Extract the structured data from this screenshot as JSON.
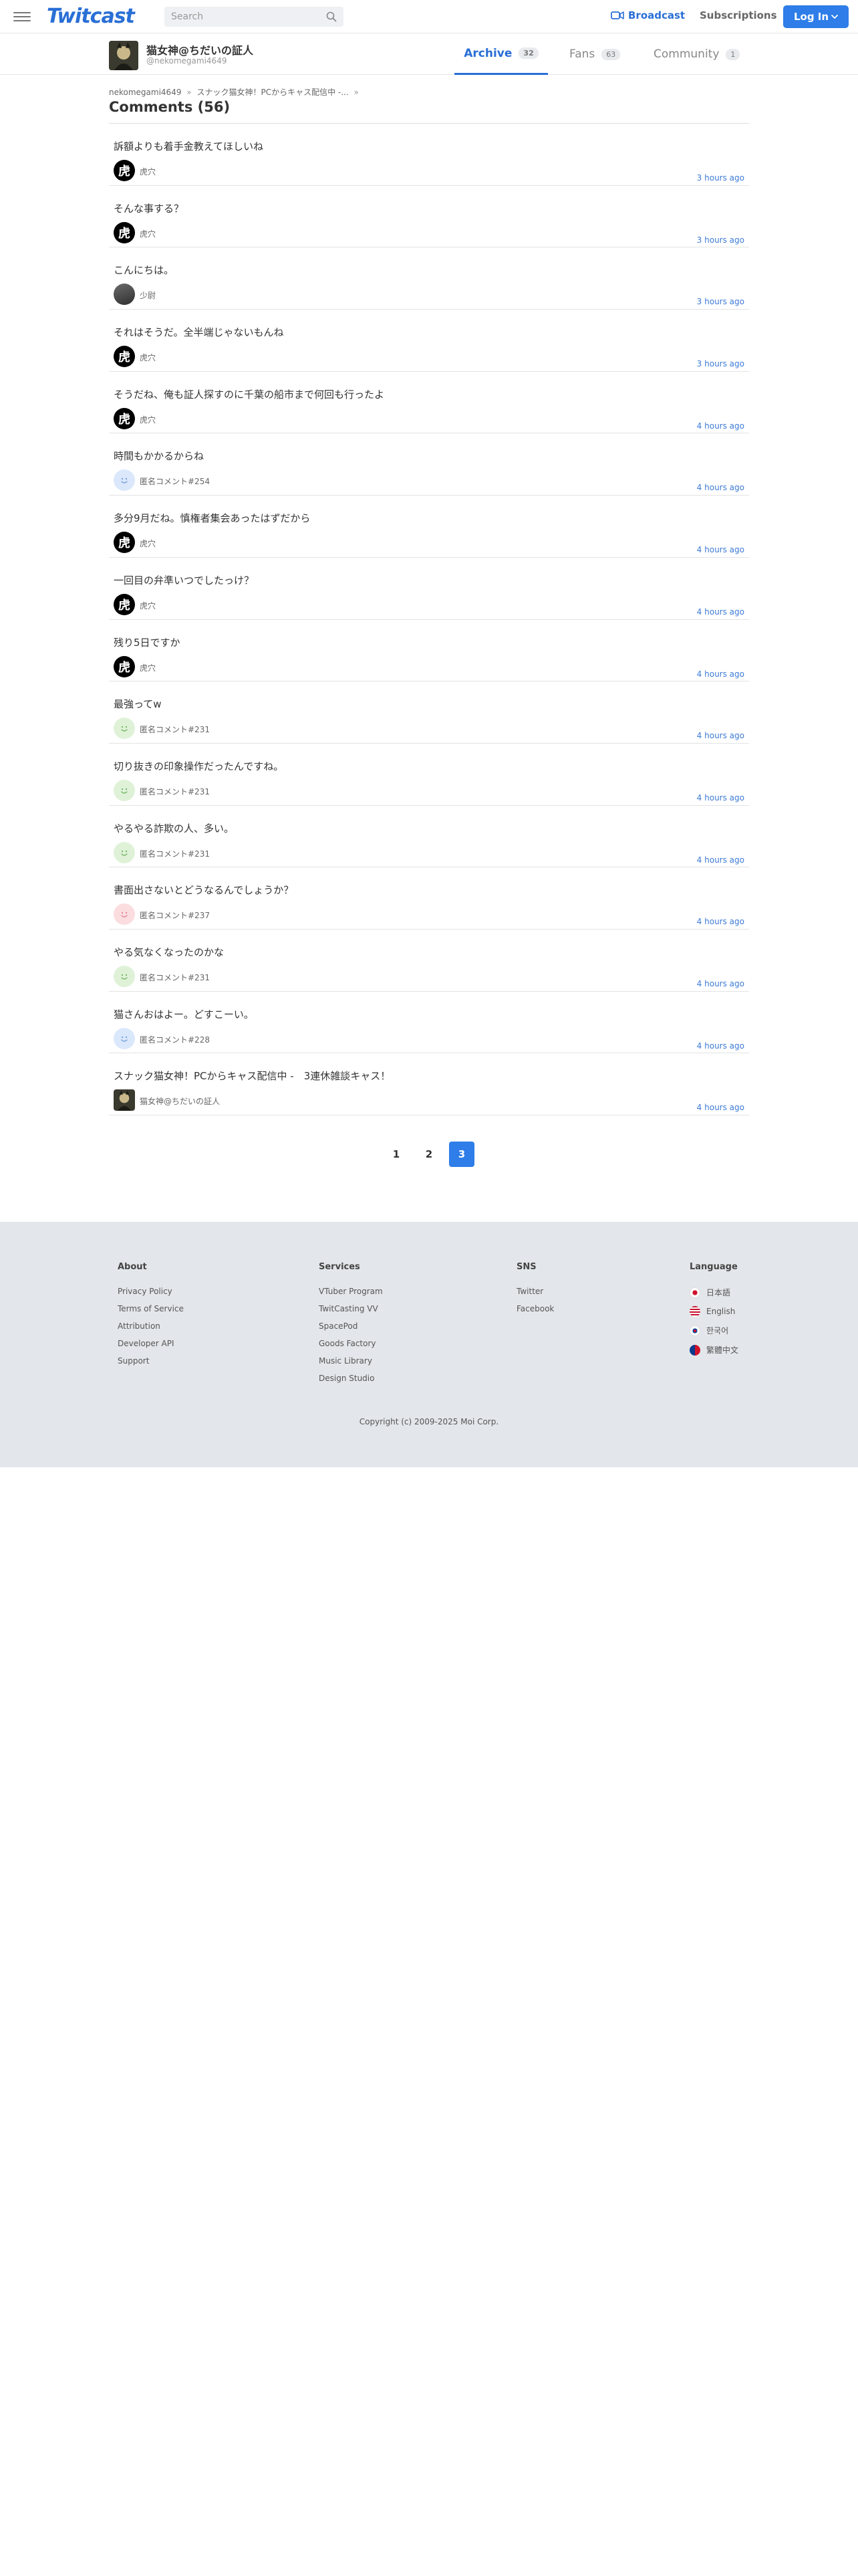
{
  "header": {
    "logo": "Twitcast",
    "search_placeholder": "Search",
    "broadcast_label": "Broadcast",
    "subscriptions_label": "Subscriptions",
    "login_label": "Log In"
  },
  "user": {
    "name": "猫女神@ちだいの証人",
    "handle": "@nekomegami4649",
    "tabs": [
      {
        "label": "Archive",
        "count": "32"
      },
      {
        "label": "Fans",
        "count": "63"
      },
      {
        "label": "Community",
        "count": "1"
      }
    ]
  },
  "breadcrumb": {
    "user": "nekomegami4649",
    "movie": "スナック猫女神！PCからキャス配信中 -..."
  },
  "page_title": "Comments (56)",
  "comments": [
    {
      "text": "訴額よりも着手金教えてほしいね",
      "name": "虎穴",
      "time": "3 hours ago"
    },
    {
      "text": "そんな事する？",
      "name": "虎穴",
      "time": "3 hours ago"
    },
    {
      "text": "こんにちは。",
      "name": "少尉",
      "time": "3 hours ago"
    },
    {
      "text": "それはそうだ。全半端じゃないもんね",
      "name": "虎穴",
      "time": "3 hours ago"
    },
    {
      "text": "そうだね、俺も証人探すのに千葉の船市まで何回も行ったよ",
      "name": "虎穴",
      "time": "4 hours ago"
    },
    {
      "text": "時間もかかるからね",
      "name": "匿名コメント#254",
      "time": "4 hours ago"
    },
    {
      "text": "多分9月だね。慎権者集会あったはずだから",
      "name": "虎穴",
      "time": "4 hours ago"
    },
    {
      "text": "一回目の弁準いつでしたっけ？",
      "name": "虎穴",
      "time": "4 hours ago"
    },
    {
      "text": "残り5日ですか",
      "name": "虎穴",
      "time": "4 hours ago"
    },
    {
      "text": "最強ってw",
      "name": "匿名コメント#231",
      "time": "4 hours ago"
    },
    {
      "text": "切り抜きの印象操作だったんですね。",
      "name": "匿名コメント#231",
      "time": "4 hours ago"
    },
    {
      "text": "やるやる詐欺の人、多い。",
      "name": "匿名コメント#231",
      "time": "4 hours ago"
    },
    {
      "text": "書面出さないとどうなるんでしょうか？",
      "name": "匿名コメント#237",
      "time": "4 hours ago"
    },
    {
      "text": "やる気なくなったのかな",
      "name": "匿名コメント#231",
      "time": "4 hours ago"
    },
    {
      "text": "猫さんおはよー。どすこーい。",
      "name": "匿名コメント#228",
      "time": "4 hours ago"
    },
    {
      "text": "スナック猫女神！PCからキャス配信中 -　3連休雑談キャス！",
      "name": "猫女神@ちだいの証人",
      "time": "4 hours ago"
    }
  ],
  "pagination": [
    "1",
    "2",
    "3"
  ],
  "footer": {
    "about": {
      "heading": "About",
      "links": [
        "Privacy Policy",
        "Terms of Service",
        "Attribution",
        "Developer API",
        "Support"
      ]
    },
    "services": {
      "heading": "Services",
      "links": [
        "VTuber Program",
        "TwitCasting VV",
        "SpacePod",
        "Goods Factory",
        "Music Library",
        "Design Studio"
      ]
    },
    "sns": {
      "heading": "SNS",
      "links": [
        "Twitter",
        "Facebook"
      ]
    },
    "language": {
      "heading": "Language",
      "links": [
        "日本語",
        "English",
        "한국어",
        "繁體中文"
      ]
    },
    "copyright": "Copyright (c) 2009-2025 Moi Corp."
  },
  "colors": {
    "accent": "#2e7de8",
    "link_blue": "#3d7bd6",
    "footer_bg": "#e3e6ea"
  }
}
